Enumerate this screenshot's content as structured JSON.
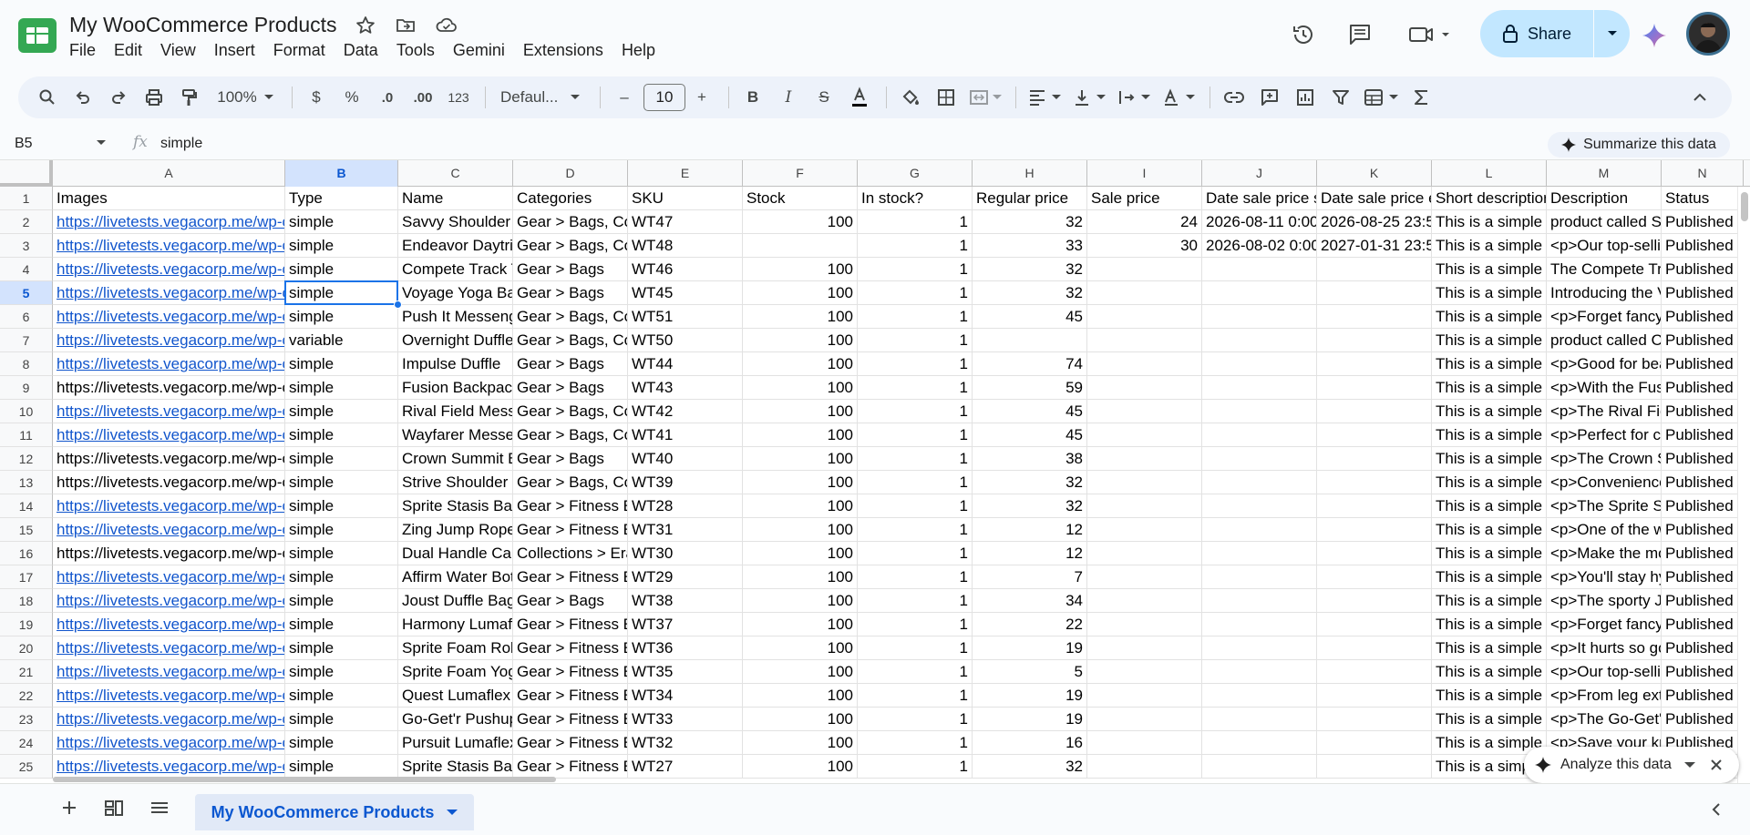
{
  "app": {
    "doc_title": "My WooCommerce Products",
    "menu": [
      "File",
      "Edit",
      "View",
      "Insert",
      "Format",
      "Data",
      "Tools",
      "Gemini",
      "Extensions",
      "Help"
    ],
    "share_label": "Share"
  },
  "toolbar": {
    "zoom": "100%",
    "currency": "$",
    "percent": "%",
    "decrease_decimal": ".0",
    "increase_decimal": ".00",
    "number_format": "123",
    "font": "Defaul...",
    "font_size": "10",
    "minus": "–",
    "plus": "+"
  },
  "formula_bar": {
    "name_box": "B5",
    "fx": "fx",
    "value": "simple",
    "summarize_label": "Summarize this data"
  },
  "columns": [
    "A",
    "B",
    "C",
    "D",
    "E",
    "F",
    "G",
    "H",
    "I",
    "J",
    "K",
    "L",
    "M",
    "N"
  ],
  "selected": {
    "row": "5",
    "col": "B"
  },
  "headers": [
    "Images",
    "Type",
    "Name",
    "Categories",
    "SKU",
    "Stock",
    "In stock?",
    "Regular price",
    "Sale price",
    "Date sale price s",
    "Date sale price e",
    "Short descriptior",
    "Description",
    "Status"
  ],
  "rows": [
    {
      "n": "2",
      "link": true,
      "c": [
        "https://livetests.vegacorp.me/wp-c",
        "simple",
        "Savvy Shoulder Ta",
        "Gear > Bags, Co",
        "WT47",
        "100",
        "1",
        "32",
        "24",
        "2026-08-11 0:00",
        "2026-08-25 23:5",
        "This is a simple p",
        "product called Sa",
        "Published"
      ]
    },
    {
      "n": "3",
      "link": true,
      "c": [
        "https://livetests.vegacorp.me/wp-c",
        "simple",
        "Endeavor Daytrip",
        "Gear > Bags, Co",
        "WT48",
        "",
        "1",
        "33",
        "30",
        "2026-08-02 0:00",
        "2027-01-31 23:5",
        "This is a simple p",
        "<p>Our top-sellin",
        "Published"
      ]
    },
    {
      "n": "4",
      "link": true,
      "c": [
        "https://livetests.vegacorp.me/wp-c",
        "simple",
        "Compete Track To",
        "Gear > Bags",
        "WT46",
        "100",
        "1",
        "32",
        "",
        "",
        "",
        "This is a simple p",
        "The Compete Tra",
        "Published"
      ]
    },
    {
      "n": "5",
      "link": true,
      "c": [
        "https://livetests.vegacorp.me/wp-c",
        "simple",
        "Voyage Yoga Bag",
        "Gear > Bags",
        "WT45",
        "100",
        "1",
        "32",
        "",
        "",
        "",
        "This is a simple p",
        "Introducing the V",
        "Published"
      ]
    },
    {
      "n": "6",
      "link": true,
      "c": [
        "https://livetests.vegacorp.me/wp-c",
        "simple",
        "Push It Messenge",
        "Gear > Bags, Co",
        "WT51",
        "100",
        "1",
        "45",
        "",
        "",
        "",
        "This is a simple p",
        "<p>Forget fancy",
        "Published"
      ]
    },
    {
      "n": "7",
      "link": true,
      "c": [
        "https://livetests.vegacorp.me/wp-c",
        "variable",
        "Overnight Duffle",
        "Gear > Bags, Co",
        "WT50",
        "100",
        "1",
        "",
        "",
        "",
        "",
        "This is a simple p",
        "product called Ov",
        "Published"
      ]
    },
    {
      "n": "8",
      "link": true,
      "c": [
        "https://livetests.vegacorp.me/wp-c",
        "simple",
        "Impulse Duffle",
        "Gear > Bags",
        "WT44",
        "100",
        "1",
        "74",
        "",
        "",
        "",
        "This is a simple p",
        "<p>Good for bea",
        "Published"
      ]
    },
    {
      "n": "9",
      "link": false,
      "c": [
        "https://livetests.vegacorp.me/wp-c",
        "simple",
        "Fusion Backpack",
        "Gear > Bags",
        "WT43",
        "100",
        "1",
        "59",
        "",
        "",
        "",
        "This is a simple p",
        "<p>With the Fus",
        "Published"
      ]
    },
    {
      "n": "10",
      "link": true,
      "c": [
        "https://livetests.vegacorp.me/wp-c",
        "simple",
        "Rival Field Messe",
        "Gear > Bags, Co",
        "WT42",
        "100",
        "1",
        "45",
        "",
        "",
        "",
        "This is a simple p",
        "<p>The Rival Fie",
        "Published"
      ]
    },
    {
      "n": "11",
      "link": true,
      "c": [
        "https://livetests.vegacorp.me/wp-c",
        "simple",
        "Wayfarer Messen",
        "Gear > Bags, Co",
        "WT41",
        "100",
        "1",
        "45",
        "",
        "",
        "",
        "This is a simple p",
        "<p>Perfect for cl",
        "Published"
      ]
    },
    {
      "n": "12",
      "link": false,
      "c": [
        "https://livetests.vegacorp.me/wp-c",
        "simple",
        "Crown Summit Ba",
        "Gear > Bags",
        "WT40",
        "100",
        "1",
        "38",
        "",
        "",
        "",
        "This is a simple p",
        "<p>The Crown S",
        "Published"
      ]
    },
    {
      "n": "13",
      "link": false,
      "c": [
        "https://livetests.vegacorp.me/wp-c",
        "simple",
        "Strive Shoulder P",
        "Gear > Bags, Co",
        "WT39",
        "100",
        "1",
        "32",
        "",
        "",
        "",
        "This is a simple p",
        "<p>Convenience",
        "Published"
      ]
    },
    {
      "n": "14",
      "link": true,
      "c": [
        "https://livetests.vegacorp.me/wp-c",
        "simple",
        "Sprite Stasis Ball",
        "Gear > Fitness E",
        "WT28",
        "100",
        "1",
        "32",
        "",
        "",
        "",
        "This is a simple p",
        "<p>The Sprite S",
        "Published"
      ]
    },
    {
      "n": "15",
      "link": true,
      "c": [
        "https://livetests.vegacorp.me/wp-c",
        "simple",
        "Zing Jump Rope",
        "Gear > Fitness E",
        "WT31",
        "100",
        "1",
        "12",
        "",
        "",
        "",
        "This is a simple p",
        "<p>One of the w",
        "Published"
      ]
    },
    {
      "n": "16",
      "link": false,
      "c": [
        "https://livetests.vegacorp.me/wp-c",
        "simple",
        "Dual Handle Card",
        "Collections > Era",
        "WT30",
        "100",
        "1",
        "12",
        "",
        "",
        "",
        "This is a simple p",
        "<p>Make the mo",
        "Published"
      ]
    },
    {
      "n": "17",
      "link": true,
      "c": [
        "https://livetests.vegacorp.me/wp-c",
        "simple",
        "Affirm Water Bott",
        "Gear > Fitness E",
        "WT29",
        "100",
        "1",
        "7",
        "",
        "",
        "",
        "This is a simple p",
        "<p>You'll stay hy",
        "Published"
      ]
    },
    {
      "n": "18",
      "link": true,
      "c": [
        "https://livetests.vegacorp.me/wp-c",
        "simple",
        "Joust Duffle Bag",
        "Gear > Bags",
        "WT38",
        "100",
        "1",
        "34",
        "",
        "",
        "",
        "This is a simple p",
        "<p>The sporty J",
        "Published"
      ]
    },
    {
      "n": "19",
      "link": true,
      "c": [
        "https://livetests.vegacorp.me/wp-c",
        "simple",
        "Harmony Lumaflex",
        "Gear > Fitness E",
        "WT37",
        "100",
        "1",
        "22",
        "",
        "",
        "",
        "This is a simple p",
        "<p>Forget fancy",
        "Published"
      ]
    },
    {
      "n": "20",
      "link": true,
      "c": [
        "https://livetests.vegacorp.me/wp-c",
        "simple",
        "Sprite Foam Roll",
        "Gear > Fitness E",
        "WT36",
        "100",
        "1",
        "19",
        "",
        "",
        "",
        "This is a simple p",
        "<p>It hurts so go",
        "Published"
      ]
    },
    {
      "n": "21",
      "link": true,
      "c": [
        "https://livetests.vegacorp.me/wp-c",
        "simple",
        "Sprite Foam Yoga",
        "Gear > Fitness E",
        "WT35",
        "100",
        "1",
        "5",
        "",
        "",
        "",
        "This is a simple p",
        "<p>Our top-sellin",
        "Published"
      ]
    },
    {
      "n": "22",
      "link": true,
      "c": [
        "https://livetests.vegacorp.me/wp-c",
        "simple",
        "Quest Lumaflex",
        "Gear > Fitness E",
        "WT34",
        "100",
        "1",
        "19",
        "",
        "",
        "",
        "This is a simple p",
        "<p>From leg ext",
        "Published"
      ]
    },
    {
      "n": "23",
      "link": true,
      "c": [
        "https://livetests.vegacorp.me/wp-c",
        "simple",
        "Go-Get'r Pushup",
        "Gear > Fitness E",
        "WT33",
        "100",
        "1",
        "19",
        "",
        "",
        "",
        "This is a simple p",
        "<p>The Go-Get'",
        "Published"
      ]
    },
    {
      "n": "24",
      "link": true,
      "c": [
        "https://livetests.vegacorp.me/wp-c",
        "simple",
        "Pursuit Lumaflex",
        "Gear > Fitness E",
        "WT32",
        "100",
        "1",
        "16",
        "",
        "",
        "",
        "This is a simple p",
        "<p>Save your kr",
        "Published"
      ]
    },
    {
      "n": "25",
      "link": true,
      "c": [
        "https://livetests.vegacorp.me/wp-c",
        "simple",
        "Sprite Stasis Ball",
        "Gear > Fitness E",
        "WT27",
        "100",
        "1",
        "32",
        "",
        "",
        "",
        "This is a simp",
        "",
        "Published"
      ]
    }
  ],
  "analyze": {
    "label": "Analyze this data"
  },
  "sheet": {
    "tab_label": "My WooCommerce Products"
  },
  "colors": {
    "accent": "#0b57d0",
    "selection": "#1a73e8",
    "link": "#1155cc",
    "share_bg": "#c2e7ff"
  }
}
